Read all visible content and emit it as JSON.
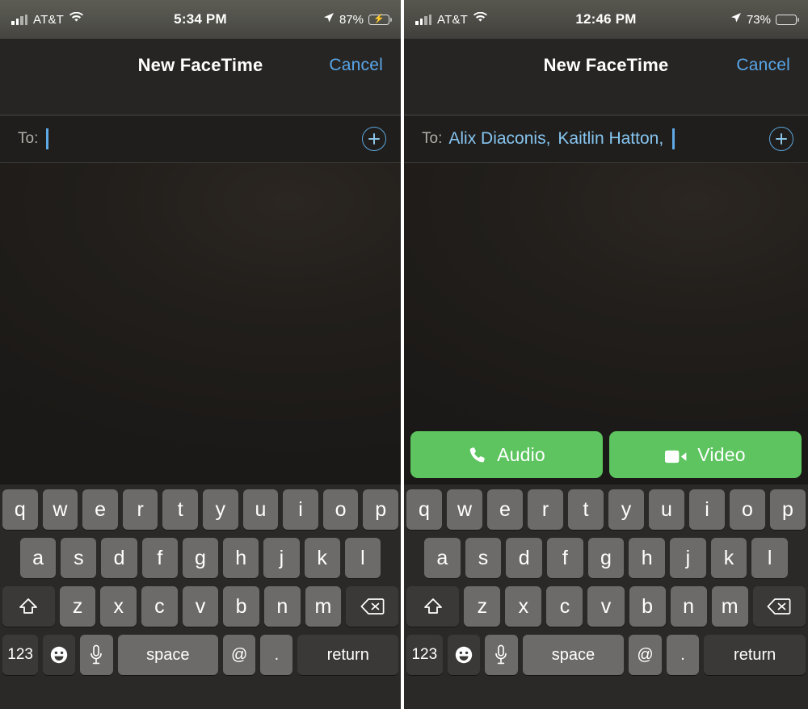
{
  "panels": [
    {
      "id": "left",
      "status": {
        "carrier": "AT&T",
        "time": "5:34 PM",
        "battery_pct": "87%",
        "signal_icon": "cellular-bars-icon",
        "wifi_icon": "wifi-icon",
        "location_icon": "location-arrow-icon",
        "battery_icon": "battery-charging-icon",
        "charging": true
      },
      "nav": {
        "title": "New FaceTime",
        "cancel_label": "Cancel"
      },
      "to_field": {
        "label": "To:",
        "recipients": [],
        "caret_visible": true,
        "add_icon": "plus-circle-icon"
      },
      "call_buttons": [],
      "show_call_buttons": false
    },
    {
      "id": "right",
      "status": {
        "carrier": "AT&T",
        "time": "12:46 PM",
        "battery_pct": "73%",
        "signal_icon": "cellular-bars-icon",
        "wifi_icon": "wifi-icon",
        "location_icon": "location-arrow-icon",
        "battery_icon": "battery-icon",
        "charging": false
      },
      "nav": {
        "title": "New FaceTime",
        "cancel_label": "Cancel"
      },
      "to_field": {
        "label": "To:",
        "recipients": [
          "Alix Diaconis",
          "Kaitlin Hatton"
        ],
        "caret_visible": true,
        "add_icon": "plus-circle-icon"
      },
      "call_buttons": [
        {
          "label": "Audio",
          "icon": "phone-icon"
        },
        {
          "label": "Video",
          "icon": "video-camera-icon"
        }
      ],
      "show_call_buttons": true
    }
  ],
  "keyboard": {
    "row1": [
      "q",
      "w",
      "e",
      "r",
      "t",
      "y",
      "u",
      "i",
      "o",
      "p"
    ],
    "row2": [
      "a",
      "s",
      "d",
      "f",
      "g",
      "h",
      "j",
      "k",
      "l"
    ],
    "row3_shift_icon": "shift-arrow-icon",
    "row3": [
      "z",
      "x",
      "c",
      "v",
      "b",
      "n",
      "m"
    ],
    "row3_delete_icon": "delete-backward-icon",
    "row4": {
      "numbers_label": "123",
      "emoji_icon": "emoji-smiley-icon",
      "dictation_icon": "microphone-icon",
      "space_label": "space",
      "at_label": "@",
      "period_label": ".",
      "return_label": "return"
    }
  },
  "colors": {
    "accent_blue": "#59a6e8",
    "token_blue": "#86c5f0",
    "call_green": "#5dc45f",
    "key_gray": "#6d6b69",
    "key_dark": "#3b3937",
    "keyboard_bg": "#2b2927",
    "nav_bg": "#272523",
    "battery_green": "#4cd05c"
  }
}
